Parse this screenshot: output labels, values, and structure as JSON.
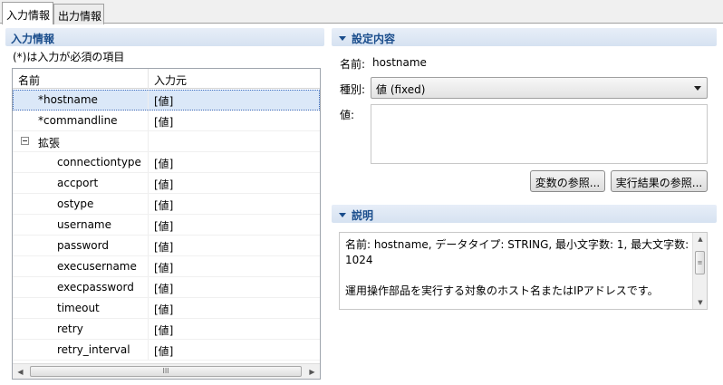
{
  "tabs": [
    {
      "label": "入力情報",
      "active": true
    },
    {
      "label": "出力情報",
      "active": false
    }
  ],
  "left_panel": {
    "title": "入力情報",
    "note": "(*)は入力が必須の項目",
    "columns": {
      "name": "名前",
      "source": "入力元"
    },
    "rows": [
      {
        "name": "*hostname",
        "source": "[値]",
        "selected": true
      },
      {
        "name": "*commandline",
        "source": "[値]"
      },
      {
        "name": "拡張",
        "source": "",
        "expander": "collapse"
      },
      {
        "name": "connectiontype",
        "source": "[値]"
      },
      {
        "name": "accport",
        "source": "[値]"
      },
      {
        "name": "ostype",
        "source": "[値]"
      },
      {
        "name": "username",
        "source": "[値]"
      },
      {
        "name": "password",
        "source": "[値]"
      },
      {
        "name": "execusername",
        "source": "[値]"
      },
      {
        "name": "execpassword",
        "source": "[値]"
      },
      {
        "name": "timeout",
        "source": "[値]"
      },
      {
        "name": "retry",
        "source": "[値]"
      },
      {
        "name": "retry_interval",
        "source": "[値]"
      }
    ],
    "scrollbar": {
      "left_arrow": "◀",
      "thumb_grip": "III",
      "right_arrow": "▶"
    }
  },
  "settings": {
    "title": "設定内容",
    "name_label": "名前:",
    "name_value": "hostname",
    "type_label": "種別:",
    "type_value": "値 (fixed)",
    "value_label": "値:",
    "value_text": "",
    "btn_variable": "変数の参照...",
    "btn_result": "実行結果の参照..."
  },
  "description": {
    "title": "説明",
    "line1": "名前: hostname, データタイプ: STRING, 最小文字数: 1, 最大文字数: 1024",
    "line2": "運用操作部品を実行する対象のホスト名またはIPアドレスです。",
    "scroll_up": "▲",
    "scroll_grip": "≡",
    "scroll_down": "▼"
  }
}
